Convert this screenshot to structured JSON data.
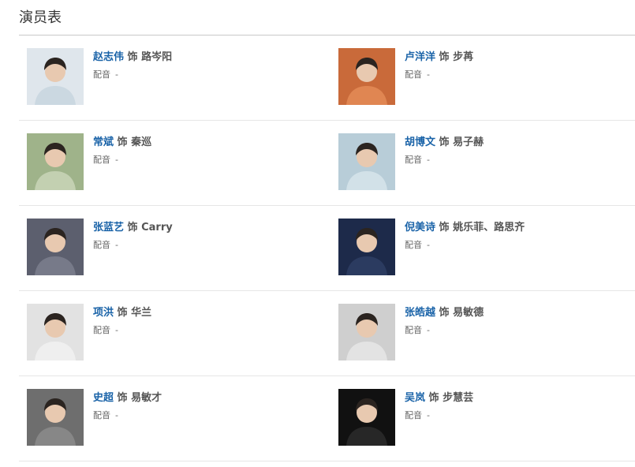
{
  "section": {
    "title": "演员表"
  },
  "labels": {
    "as_word": "饰",
    "dub_label": "配音",
    "dub_empty": "-"
  },
  "cast": [
    {
      "actor": "赵志伟",
      "role": "路岑阳",
      "dub": "-",
      "photo_bg": "#dfe6ec",
      "photo_tone": "#c9d6e0"
    },
    {
      "actor": "卢洋洋",
      "role": "步苒",
      "dub": "-",
      "photo_bg": "#c96a3a",
      "photo_tone": "#e28a55"
    },
    {
      "actor": "常斌",
      "role": "秦巡",
      "dub": "-",
      "photo_bg": "#9fb38a",
      "photo_tone": "#c7d3b5"
    },
    {
      "actor": "胡博文",
      "role": "易子赫",
      "dub": "-",
      "photo_bg": "#b8cdd8",
      "photo_tone": "#d5e3ea"
    },
    {
      "actor": "张蓝艺",
      "role": "Carry",
      "dub": "-",
      "photo_bg": "#5c5f6e",
      "photo_tone": "#7a7d8c"
    },
    {
      "actor": "倪美诗",
      "role": "姚乐菲、路思齐",
      "dub": "-",
      "photo_bg": "#1d2a4a",
      "photo_tone": "#2e3d63"
    },
    {
      "actor": "项洪",
      "role": "华兰",
      "dub": "-",
      "photo_bg": "#e2e2e2",
      "photo_tone": "#f1f1f1"
    },
    {
      "actor": "张皓越",
      "role": "易敏德",
      "dub": "-",
      "photo_bg": "#cfcfcf",
      "photo_tone": "#e4e4e4"
    },
    {
      "actor": "史超",
      "role": "易敏才",
      "dub": "-",
      "photo_bg": "#6e6e6e",
      "photo_tone": "#8a8a8a"
    },
    {
      "actor": "吴岚",
      "role": "步慧芸",
      "dub": "-",
      "photo_bg": "#111111",
      "photo_tone": "#2a2a2a"
    }
  ]
}
